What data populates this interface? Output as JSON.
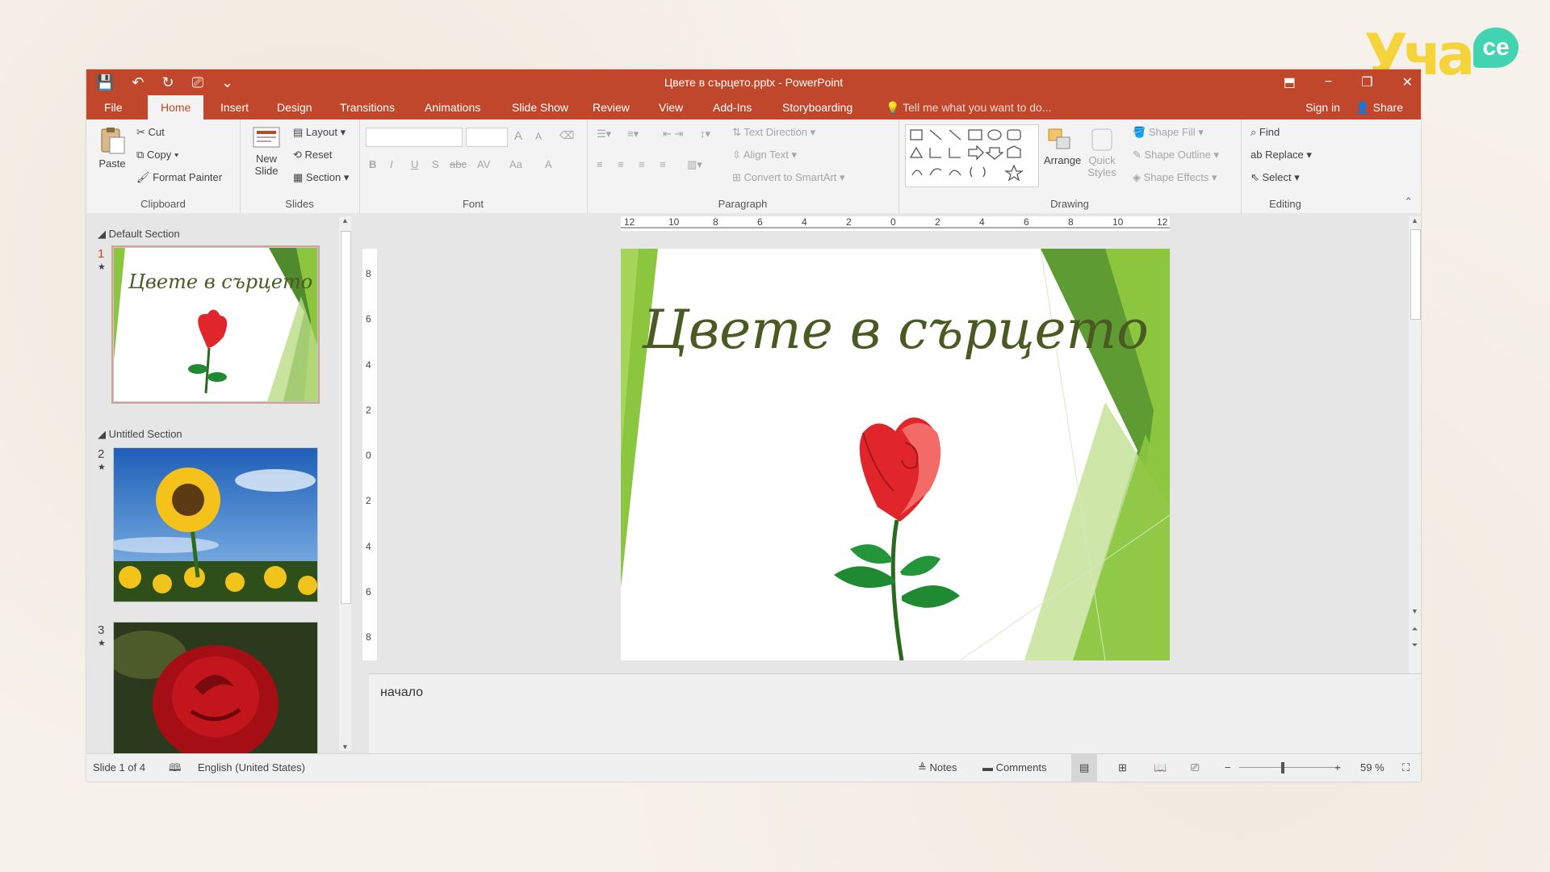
{
  "logo": {
    "text": "Уча",
    "badge": "се"
  },
  "window": {
    "title": "Цвете в сърцето.pptx - PowerPoint",
    "qat": {
      "save": "💾",
      "undo": "↶",
      "redo": "↻",
      "present": "⎚",
      "more": "⌄"
    },
    "controls": {
      "ribbon_opts": "⬒",
      "minimize": "−",
      "restore": "❐",
      "close": "✕"
    }
  },
  "tabs": [
    "File",
    "Home",
    "Insert",
    "Design",
    "Transitions",
    "Animations",
    "Slide Show",
    "Review",
    "View",
    "Add-Ins",
    "Storyboarding"
  ],
  "active_tab": "Home",
  "tell_me": "Tell me what you want to do...",
  "sign_in": "Sign in",
  "share": "Share",
  "ribbon": {
    "clipboard": {
      "label": "Clipboard",
      "paste": "Paste",
      "cut": "Cut",
      "copy": "Copy",
      "format_painter": "Format Painter"
    },
    "slides": {
      "label": "Slides",
      "new_slide": "New",
      "new_slide2": "Slide",
      "layout": "Layout",
      "reset": "Reset",
      "section": "Section"
    },
    "font": {
      "label": "Font",
      "bold": "B",
      "italic": "I",
      "underline": "U",
      "shadow": "S",
      "strike": "abc",
      "spacing": "AV",
      "case": "Aa",
      "color": "A",
      "grow": "A",
      "shrink": "A"
    },
    "paragraph": {
      "label": "Paragraph",
      "text_direction": "Text Direction",
      "align_text": "Align Text",
      "convert_smartart": "Convert to SmartArt"
    },
    "drawing": {
      "label": "Drawing",
      "arrange": "Arrange",
      "quick_styles": "Quick",
      "quick_styles2": "Styles",
      "shape_fill": "Shape Fill",
      "shape_outline": "Shape Outline",
      "shape_effects": "Shape Effects"
    },
    "editing": {
      "label": "Editing",
      "find": "Find",
      "replace": "Replace",
      "select": "Select"
    }
  },
  "slides_panel": {
    "sections": [
      {
        "name": "Default Section"
      },
      {
        "name": "Untitled Section"
      }
    ],
    "slides": [
      {
        "number": "1"
      },
      {
        "number": "2"
      },
      {
        "number": "3"
      }
    ]
  },
  "ruler": {
    "horizontal": [
      "12",
      "10",
      "8",
      "6",
      "4",
      "2",
      "0",
      "2",
      "4",
      "6",
      "8",
      "10",
      "12"
    ],
    "vertical": [
      "8",
      "6",
      "4",
      "2",
      "0",
      "2",
      "4",
      "6",
      "8"
    ]
  },
  "slide": {
    "title": "Цвете в сърцето"
  },
  "notes": "начало",
  "status": {
    "slide_of": "Slide 1 of 4",
    "language": "English (United States)",
    "notes": "Notes",
    "comments": "Comments",
    "zoom": "59 %"
  },
  "colors": {
    "accent": "#c0472b",
    "green_dark": "#4f8a2c",
    "green_light": "#8fc43c"
  }
}
